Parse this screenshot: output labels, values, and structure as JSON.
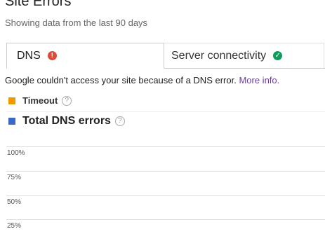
{
  "header": {
    "title": "Site Errors",
    "subtitle": "Showing data from the last 90 days"
  },
  "tabs": [
    {
      "label": "DNS",
      "status_icon": "error-icon",
      "status_color": "#dd4b39",
      "selected": true
    },
    {
      "label": "Server connectivity",
      "status_icon": "check-icon",
      "status_color": "#0f9d58",
      "selected": false
    }
  ],
  "message": {
    "text": "Google couldn't access your site because of a DNS error.",
    "link": "More info."
  },
  "legend": {
    "timeout": {
      "label": "Timeout",
      "color": "#f29900"
    },
    "total": {
      "label": "Total DNS errors",
      "color": "#3a68c8"
    }
  },
  "chart_data": {
    "type": "line",
    "y_tick_labels": [
      "100%",
      "75%",
      "50%",
      "25%"
    ],
    "grid": true
  }
}
